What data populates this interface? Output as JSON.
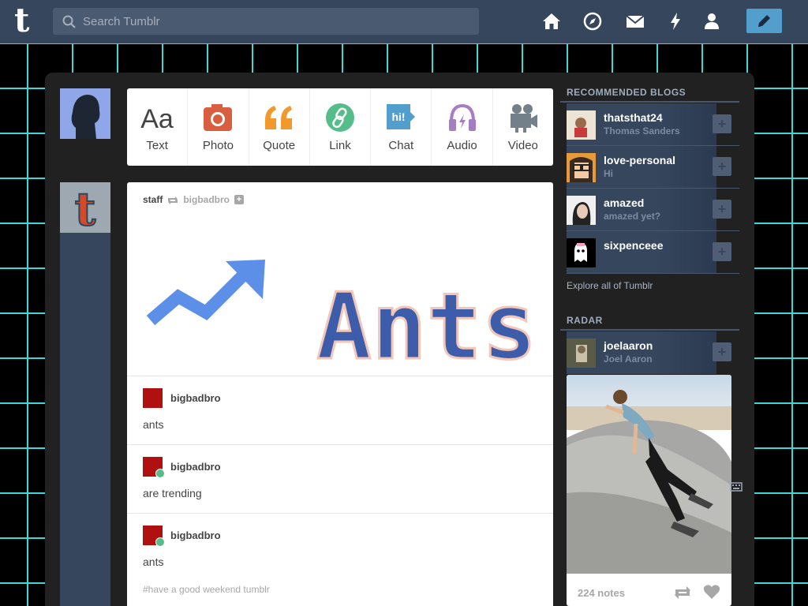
{
  "header": {
    "logo": "t",
    "search_placeholder": "Search Tumblr",
    "nav": [
      "home-icon",
      "explore-icon",
      "inbox-icon",
      "activity-icon",
      "account-icon"
    ],
    "compose": "compose-icon",
    "color": "#36465d",
    "accent": "#529ecc"
  },
  "post_types": [
    {
      "label": "Text",
      "icon": "text-icon",
      "color": "#444444"
    },
    {
      "label": "Photo",
      "icon": "photo-icon",
      "color": "#d95e40"
    },
    {
      "label": "Quote",
      "icon": "quote-icon",
      "color": "#f2992e"
    },
    {
      "label": "Link",
      "icon": "link-icon",
      "color": "#56bc8a"
    },
    {
      "label": "Chat",
      "icon": "chat-icon",
      "color": "#529ecc"
    },
    {
      "label": "Audio",
      "icon": "audio-icon",
      "color": "#a77dc2"
    },
    {
      "label": "Video",
      "icon": "video-icon",
      "color": "#748089"
    }
  ],
  "post": {
    "author": "staff",
    "reblogged_from": "bigbadbro",
    "image_text": "Ants",
    "entries": [
      {
        "user": "bigbadbro",
        "text": "ants"
      },
      {
        "user": "bigbadbro",
        "text": "are trending"
      },
      {
        "user": "bigbadbro",
        "text": "ants"
      }
    ],
    "tags": "#have a good weekend tumblr"
  },
  "sidebar": {
    "recommended_title": "RECOMMENDED BLOGS",
    "blogs": [
      {
        "name": "thatsthat24",
        "sub": "Thomas Sanders"
      },
      {
        "name": "love-personal",
        "sub": "Hi"
      },
      {
        "name": "amazed",
        "sub": "amazed yet?"
      },
      {
        "name": "sixpenceee",
        "sub": ""
      }
    ],
    "explore": "Explore all of Tumblr",
    "radar_title": "RADAR",
    "radar_blog": {
      "name": "joelaaron",
      "sub": "Joel Aaron"
    },
    "notes": "224 notes"
  }
}
